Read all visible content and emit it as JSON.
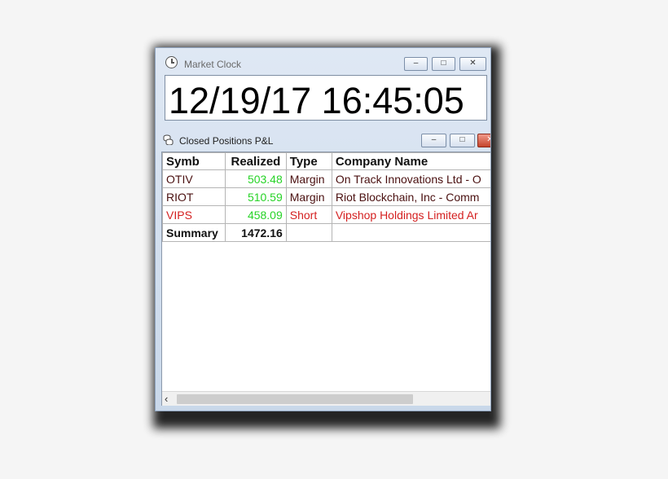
{
  "market_clock": {
    "title": "Market Clock",
    "display": "12/19/17 16:45:05",
    "controls": {
      "minimize": "–",
      "maximize": "□",
      "close": "✕"
    }
  },
  "closed_positions": {
    "title": "Closed Positions P&L",
    "controls": {
      "minimize": "–",
      "maximize": "□",
      "close": "✕"
    },
    "columns": [
      "Symb",
      "Realized",
      "Type",
      "Company Name"
    ],
    "rows": [
      {
        "symb": "OTIV",
        "realized": "503.48",
        "type": "Margin",
        "company": "On Track Innovations Ltd - O"
      },
      {
        "symb": "RIOT",
        "realized": "510.59",
        "type": "Margin",
        "company": "Riot Blockchain, Inc - Comm"
      },
      {
        "symb": "VIPS",
        "realized": "458.09",
        "type": "Short",
        "company": "Vipshop Holdings Limited Ar"
      }
    ],
    "summary": {
      "label": "Summary",
      "realized": "1472.16"
    },
    "scroll_left_icon": "‹"
  },
  "colors": {
    "profit": "#27d327",
    "short_row": "#d42020",
    "text_row": "#4a1010"
  },
  "icons": {
    "clock": "clock-icon",
    "pl": "coins-icon"
  }
}
